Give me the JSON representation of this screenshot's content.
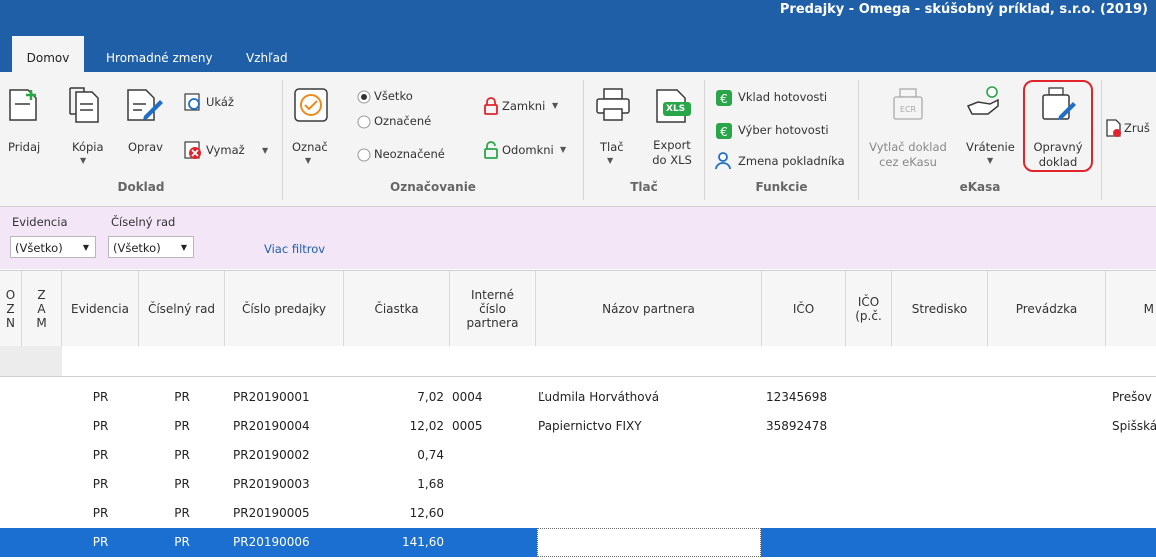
{
  "window": {
    "title": "Predajky - Omega - skúšobný príklad, s.r.o. (2019)"
  },
  "tabs": [
    {
      "label": "Domov",
      "active": true
    },
    {
      "label": "Hromadné zmeny",
      "active": false
    },
    {
      "label": "Vzhľad",
      "active": false
    }
  ],
  "ribbon": {
    "doklad": {
      "title": "Doklad",
      "pridaj": "Pridaj",
      "kopia": "Kópia",
      "oprav": "Oprav",
      "ukaz": "Ukáž",
      "vymaz": "Vymaž"
    },
    "oznacovanie": {
      "title": "Označovanie",
      "oznac": "Označ",
      "vsetko": "Všetko",
      "oznacene": "Označené",
      "neoznacene": "Neoznačené",
      "zamkni": "Zamkni",
      "odomkni": "Odomkni"
    },
    "tlac": {
      "title": "Tlač",
      "tlac": "Tlač",
      "export_line1": "Export",
      "export_line2": "do XLS",
      "xls_badge": "XLS"
    },
    "funkcie": {
      "title": "Funkcie",
      "vklad": "Vklad hotovosti",
      "vyber": "Výber hotovosti",
      "zmena": "Zmena pokladníka"
    },
    "ekasa": {
      "title": "eKasa",
      "vytlac_line1": "Vytlač doklad",
      "vytlac_line2": "cez eKasu",
      "vratenie": "Vrátenie",
      "opravny_line1": "Opravný",
      "opravny_line2": "doklad",
      "zrus": "Zruš"
    }
  },
  "filters": {
    "evidencia_label": "Evidencia",
    "evidencia_value": "(Všetko)",
    "ciselny_rad_label": "Číselný rad",
    "ciselny_rad_value": "(Všetko)",
    "more_filters": "Viac filtrov"
  },
  "grid": {
    "headers": {
      "ozn": [
        "O",
        "Z",
        "N"
      ],
      "zam": [
        "Z",
        "A",
        "M"
      ],
      "evidencia": "Evidencia",
      "ciselny_rad": "Číselný rad",
      "cislo_predajky": "Číslo predajky",
      "ciastka": "Čiastka",
      "interne_1": "Interné",
      "interne_2": "číslo",
      "interne_3": "partnera",
      "nazov_partnera": "Názov partnera",
      "ico": "IČO",
      "ico_pc_1": "IČO",
      "ico_pc_2": "(p.č.",
      "stredisko": "Stredisko",
      "prevadzka": "Prevádzka",
      "more": "M"
    },
    "rows": [
      {
        "evidencia": "PR",
        "rad": "PR",
        "cislo": "PR20190001",
        "ciastka": "7,02",
        "interne": "0004",
        "partner": "Ľudmila Horváthová",
        "ico": "12345698",
        "mesto": "Prešov",
        "selected": false
      },
      {
        "evidencia": "PR",
        "rad": "PR",
        "cislo": "PR20190004",
        "ciastka": "12,02",
        "interne": "0005",
        "partner": "Papiernictvo FIXY",
        "ico": "35892478",
        "mesto": "Spišská",
        "selected": false
      },
      {
        "evidencia": "PR",
        "rad": "PR",
        "cislo": "PR20190002",
        "ciastka": "0,74",
        "interne": "",
        "partner": "",
        "ico": "",
        "mesto": "",
        "selected": false
      },
      {
        "evidencia": "PR",
        "rad": "PR",
        "cislo": "PR20190003",
        "ciastka": "1,68",
        "interne": "",
        "partner": "",
        "ico": "",
        "mesto": "",
        "selected": false
      },
      {
        "evidencia": "PR",
        "rad": "PR",
        "cislo": "PR20190005",
        "ciastka": "12,60",
        "interne": "",
        "partner": "",
        "ico": "",
        "mesto": "",
        "selected": false
      },
      {
        "evidencia": "PR",
        "rad": "PR",
        "cislo": "PR20190006",
        "ciastka": "141,60",
        "interne": "",
        "partner": "",
        "ico": "",
        "mesto": "",
        "selected": true
      }
    ]
  },
  "colors": {
    "accent": "#1f5fa8",
    "filter_bg": "#f3e6f7",
    "selection": "#1a6fd0",
    "highlight_border": "#e0242c"
  }
}
